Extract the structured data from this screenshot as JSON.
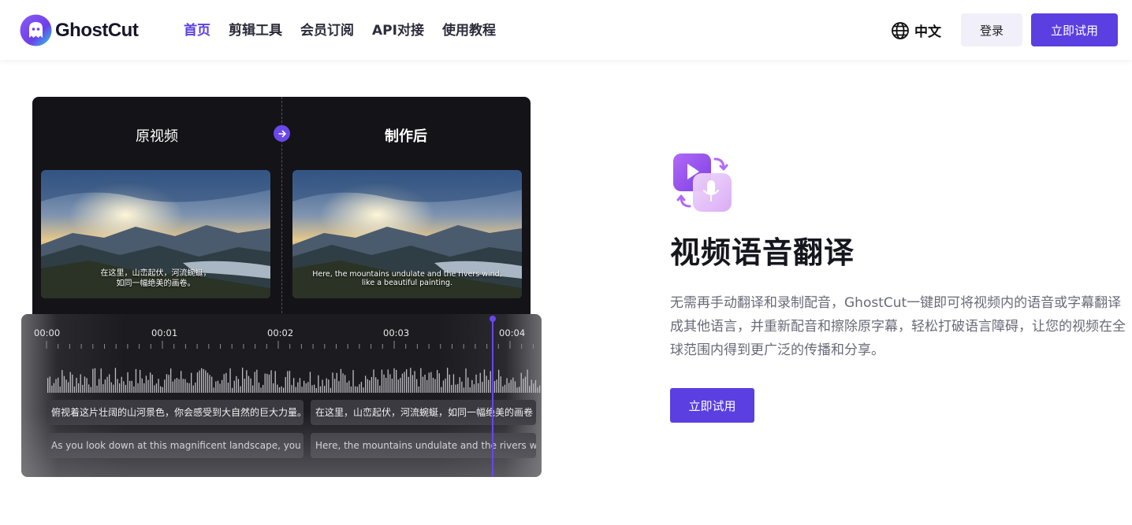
{
  "header": {
    "logo_text": "GhostCut",
    "nav": [
      {
        "label": "首页",
        "active": true
      },
      {
        "label": "剪辑工具",
        "active": false
      },
      {
        "label": "会员订阅",
        "active": false
      },
      {
        "label": "API对接",
        "active": false
      },
      {
        "label": "使用教程",
        "active": false
      }
    ],
    "language": "中文",
    "login_label": "登录",
    "try_label": "立即试用"
  },
  "demo": {
    "original_label": "原视频",
    "result_label": "制作后",
    "original_subtitle_line1": "在这里，山峦起伏，河流蜿蜒，",
    "original_subtitle_line2": "如同一幅绝美的画卷。",
    "result_subtitle_line1": "Here, the mountains undulate and the rivers wind,",
    "result_subtitle_line2": "like a beautiful painting."
  },
  "timeline": {
    "ticks": [
      "00:00",
      "00:01",
      "00:02",
      "00:03",
      "00:04"
    ],
    "cn_tracks": [
      "俯视着这片壮阔的山河景色，你会感受到大自然的巨大力量。",
      "在这里，山峦起伏，河流蜿蜒，如同一幅绝美的画卷"
    ],
    "en_tracks": [
      "As you look down at this magnificent landscape, you can",
      "Here, the mountains undulate and the rivers wind"
    ]
  },
  "feature": {
    "title": "视频语音翻译",
    "description": "无需再手动翻译和录制配音，GhostCut一键即可将视频内的语音或字幕翻译成其他语言，并重新配音和擦除原字幕，轻松打破语言障碍，让您的视频在全球范围内得到更广泛的传播和分享。",
    "cta_label": "立即试用"
  },
  "colors": {
    "accent": "#5b3fe0",
    "nav_active": "#5b3fe0",
    "text_dark": "#16161e",
    "text_muted": "#6a6a78"
  },
  "icons": [
    "ghost-logo-icon",
    "globe-icon",
    "arrow-right-icon",
    "video-voice-translate-icon"
  ]
}
